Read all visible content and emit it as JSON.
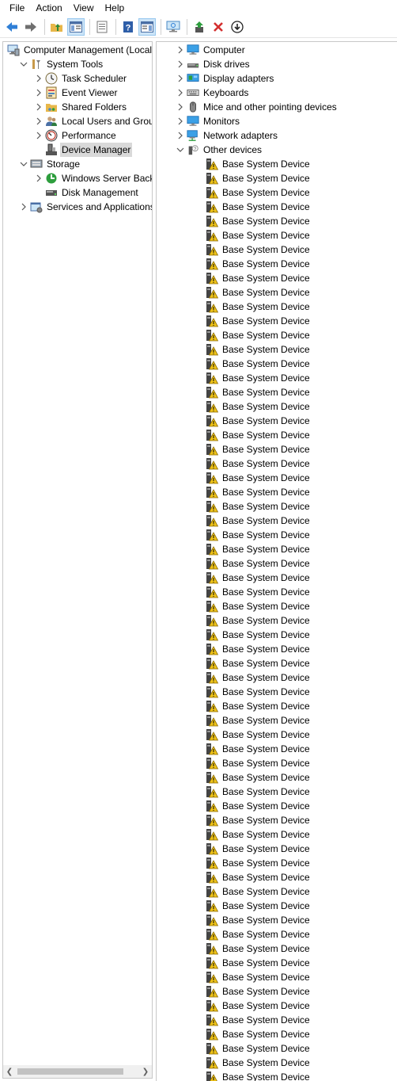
{
  "menubar": {
    "items": [
      "File",
      "Action",
      "View",
      "Help"
    ]
  },
  "toolbar": {
    "buttons": [
      {
        "name": "back-icon",
        "pressed": false
      },
      {
        "name": "forward-icon",
        "pressed": false
      },
      {
        "name": "up-folder-icon",
        "pressed": false
      },
      {
        "name": "show-hide-console-tree-icon",
        "pressed": true
      },
      {
        "name": "properties-icon",
        "pressed": false
      },
      {
        "name": "help-icon",
        "pressed": false
      },
      {
        "name": "show-hide-action-pane-icon",
        "pressed": true
      },
      {
        "name": "scan-hardware-icon",
        "pressed": false
      },
      {
        "name": "update-driver-icon",
        "pressed": false
      },
      {
        "name": "uninstall-device-icon",
        "pressed": false
      },
      {
        "name": "disable-device-icon",
        "pressed": false
      }
    ]
  },
  "left_tree": {
    "items": [
      {
        "label": "Computer Management (Local",
        "icon": "computer-management-icon",
        "expander": "none"
      },
      {
        "label": "System Tools",
        "icon": "system-tools-icon",
        "expander": "expanded"
      },
      {
        "label": "Task Scheduler",
        "icon": "task-scheduler-icon",
        "expander": "collapsed"
      },
      {
        "label": "Event Viewer",
        "icon": "event-viewer-icon",
        "expander": "collapsed"
      },
      {
        "label": "Shared Folders",
        "icon": "shared-folders-icon",
        "expander": "collapsed"
      },
      {
        "label": "Local Users and Groups",
        "icon": "local-users-icon",
        "expander": "collapsed"
      },
      {
        "label": "Performance",
        "icon": "performance-icon",
        "expander": "collapsed"
      },
      {
        "label": "Device Manager",
        "icon": "device-manager-icon",
        "expander": "none",
        "selected": true
      },
      {
        "label": "Storage",
        "icon": "storage-icon",
        "expander": "expanded"
      },
      {
        "label": "Windows Server Backup",
        "icon": "windows-server-backup-icon",
        "expander": "collapsed"
      },
      {
        "label": "Disk Management",
        "icon": "disk-management-icon",
        "expander": "none"
      },
      {
        "label": "Services and Applications",
        "icon": "services-applications-icon",
        "expander": "collapsed"
      }
    ]
  },
  "device_tree": {
    "categories": [
      {
        "label": "Computer",
        "icon": "computer-icon",
        "expander": "collapsed"
      },
      {
        "label": "Disk drives",
        "icon": "disk-drive-icon",
        "expander": "collapsed"
      },
      {
        "label": "Display adapters",
        "icon": "display-adapter-icon",
        "expander": "collapsed"
      },
      {
        "label": "Keyboards",
        "icon": "keyboard-icon",
        "expander": "collapsed"
      },
      {
        "label": "Mice and other pointing devices",
        "icon": "mouse-icon",
        "expander": "collapsed"
      },
      {
        "label": "Monitors",
        "icon": "monitor-icon",
        "expander": "collapsed"
      },
      {
        "label": "Network adapters",
        "icon": "network-adapter-icon",
        "expander": "collapsed"
      },
      {
        "label": "Other devices",
        "icon": "other-devices-icon",
        "expander": "expanded"
      }
    ],
    "other_devices": {
      "device_label": "Base System Device",
      "device_icon": "warning-device-icon",
      "visible_count": 65
    }
  },
  "colors": {
    "selection": "#d9d9d9",
    "pressed_button": "#cce4f7",
    "warning": "#f0c419",
    "error_red": "#d32f2f"
  }
}
